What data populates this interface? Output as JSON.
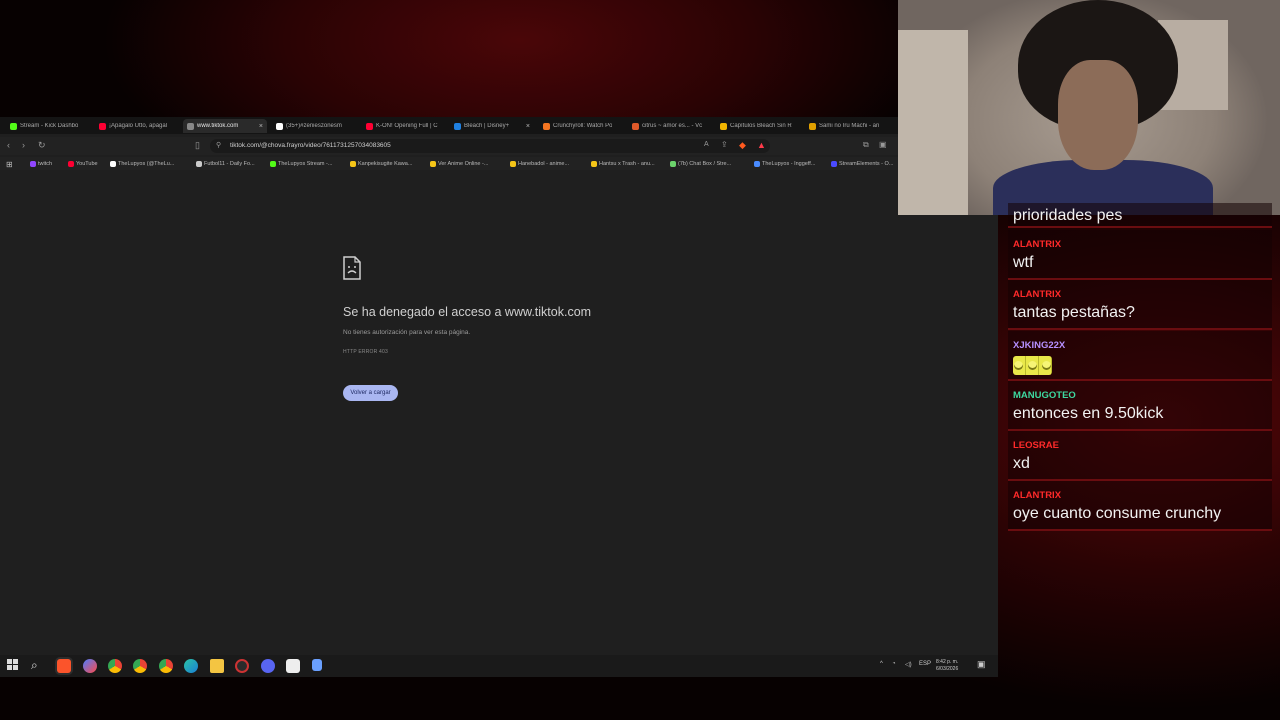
{
  "browser": {
    "tabs": [
      {
        "label": "Stream - Kick Dashbo",
        "color": "#53fc18",
        "active": false
      },
      {
        "label": "¡Apágalo Utto, apágal",
        "color": "#ff0033",
        "active": false
      },
      {
        "label": "www.tiktok.com",
        "color": "#888888",
        "active": true
      },
      {
        "label": "(35+)#zenieszonesm",
        "color": "#ffffff",
        "active": false
      },
      {
        "label": "K-ON! Opening Full | C",
        "color": "#ff0033",
        "active": false
      },
      {
        "label": "Bleach | Disney+",
        "color": "#1f80e0",
        "active": false
      },
      {
        "label": "Crunchyroll: Watch Po",
        "color": "#f47521",
        "active": false
      },
      {
        "label": "citrus ~ amor es... - Vc",
        "color": "#e05a2a",
        "active": false
      },
      {
        "label": "Capítulos Bleach Sin R",
        "color": "#f0b400",
        "active": false
      },
      {
        "label": "Sami no Iru Machi - an",
        "color": "#e0a000",
        "active": false
      }
    ],
    "url": "tiktok.com/@chova.frayro/video/7611731257034083605",
    "bookmarks": [
      {
        "label": "twitch",
        "color": "#9146ff"
      },
      {
        "label": "YouTube",
        "color": "#ff0033"
      },
      {
        "label": "TheLupyos (@TheLu...",
        "color": "#ffffff"
      },
      {
        "label": "Futbol11 - Daily Fo...",
        "color": "#cccccc"
      },
      {
        "label": "TheLupyos Stream -...",
        "color": "#53fc18"
      },
      {
        "label": "Kanpekisugite Kawa...",
        "color": "#f5c518"
      },
      {
        "label": "Ver Anime Online -...",
        "color": "#f5c518"
      },
      {
        "label": "Hanebadol - anime...",
        "color": "#f5c518"
      },
      {
        "label": "Hantsu x Trash - anu...",
        "color": "#f5c518"
      },
      {
        "label": "(7b) Chat Box / Stre...",
        "color": "#6cd36c"
      },
      {
        "label": "TheLupyos - Inggeff...",
        "color": "#4a8cff"
      },
      {
        "label": "StreamElements - O...",
        "color": "#4a4aff"
      }
    ],
    "error": {
      "title": "Se ha denegado el acceso a www.tiktok.com",
      "subtitle": "No tienes autorización para ver esta página.",
      "code": "HTTP ERROR 403",
      "reload_label": "Volver a cargar"
    }
  },
  "taskbar": {
    "language": "ESP",
    "time": "8:42 p. m.",
    "date": "6/03/2026"
  },
  "chat": {
    "partial_top": "prioridades pes",
    "messages": [
      {
        "user": "ALANTRIX",
        "text": "wtf",
        "color": "#ff2a2a"
      },
      {
        "user": "ALANTRIX",
        "text": "tantas pestañas?",
        "color": "#ff2a2a"
      },
      {
        "user": "XJKING22X",
        "text": "",
        "color": "#b690ff",
        "emote": true
      },
      {
        "user": "MANUGOTEO",
        "text": "entonces en 9.50kick",
        "color": "#3dd9a0"
      },
      {
        "user": "LEOSRAE",
        "text": "xd",
        "color": "#ff2a2a"
      },
      {
        "user": "ALANTRIX",
        "text": "oye cuanto consume crunchy",
        "color": "#ff2a2a"
      }
    ]
  }
}
